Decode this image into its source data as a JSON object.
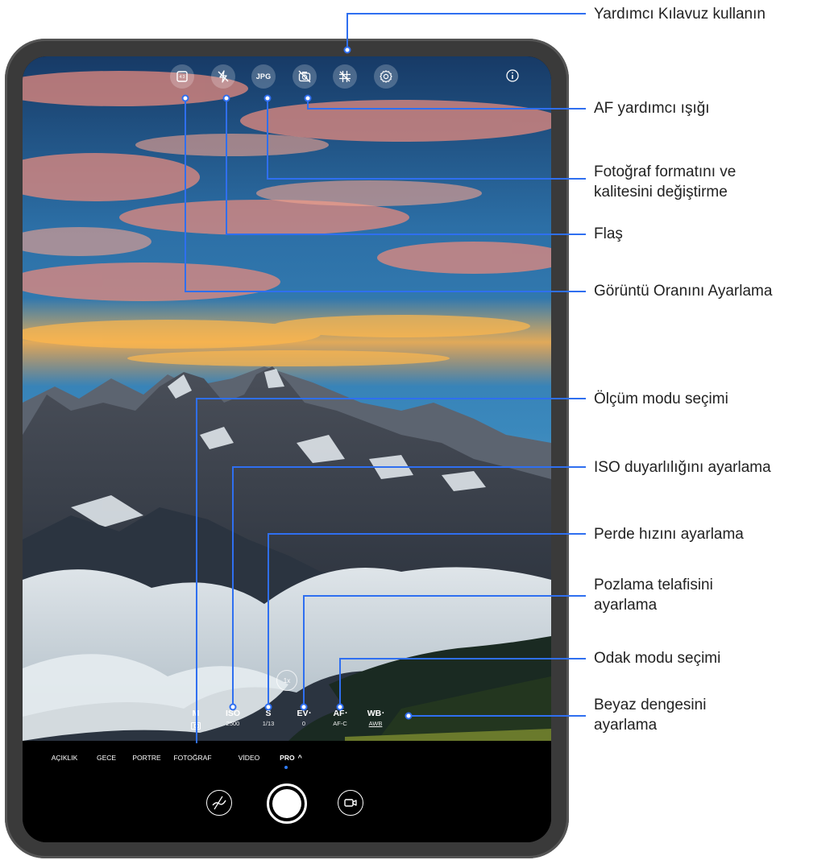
{
  "top_icons": [
    {
      "name": "aspect-ratio-icon",
      "label": "4:3"
    },
    {
      "name": "flash-off-icon",
      "label": ""
    },
    {
      "name": "photo-format-icon",
      "label": "JPG"
    },
    {
      "name": "af-assist-light-icon",
      "label": ""
    },
    {
      "name": "assistive-grid-icon",
      "label": ""
    },
    {
      "name": "settings-gear-icon",
      "label": ""
    },
    {
      "name": "info-icon",
      "label": ""
    }
  ],
  "zoom": "1x",
  "pro_params": [
    {
      "label": "M",
      "value": ""
    },
    {
      "label": "ISO",
      "value": "2500"
    },
    {
      "label": "S",
      "value": "1/13"
    },
    {
      "label": "EV",
      "value": "0"
    },
    {
      "label": "AF",
      "value": "AF-C"
    },
    {
      "label": "WB",
      "value": "AWB"
    }
  ],
  "modes": [
    "AÇIKLIK",
    "GECE",
    "PORTRE",
    "FOTOĞRAF",
    "VİDEO",
    "PRO"
  ],
  "active_mode": "PRO",
  "colors": {
    "accent": "#2f7cf6",
    "callout_line": "#2f6ff0"
  },
  "callouts": {
    "guide": "Yardımcı Kılavuz kullanın",
    "af_light": "AF yardımcı ışığı",
    "format": "Fotoğraf formatını ve\nkalitesini değiştirme",
    "flash": "Flaş",
    "ratio": "Görüntü Oranını Ayarlama",
    "metering": "Ölçüm modu seçimi",
    "iso": "ISO duyarlılığını ayarlama",
    "shutter": "Perde hızını ayarlama",
    "ev": "Pozlama telafisini\nayarlama",
    "focus": "Odak modu seçimi",
    "wb": "Beyaz dengesini\nayarlama"
  }
}
